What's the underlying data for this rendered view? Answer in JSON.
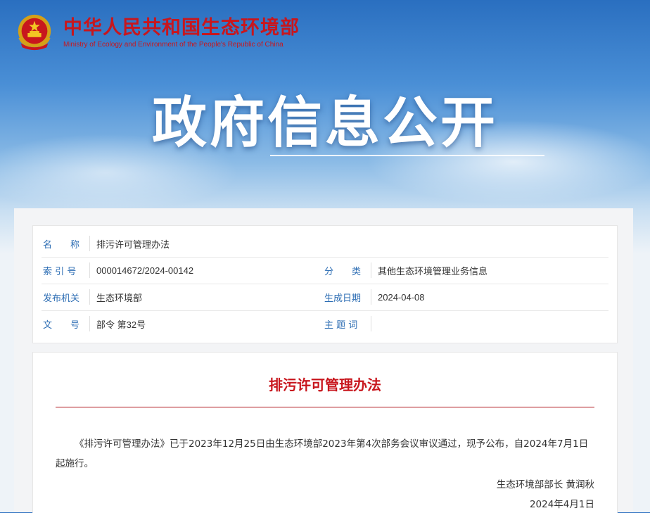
{
  "site": {
    "name_cn": "中华人民共和国生态环境部",
    "name_en": "Ministry of Ecology and Environment of the People's Republic of China",
    "emblem_icon": "national-emblem-icon",
    "brand_color": "#c8161d"
  },
  "banner": {
    "title": "政府信息公开"
  },
  "info": {
    "name_label": "名　　称",
    "name_value": "排污许可管理办法",
    "index_label": "索 引 号",
    "index_value": "000014672/2024-00142",
    "category_label": "分　　类",
    "category_value": "其他生态环境管理业务信息",
    "issuer_label": "发布机关",
    "issuer_value": "生态环境部",
    "date_label": "生成日期",
    "date_value": "2024-04-08",
    "doc_no_label": "文　　号",
    "doc_no_value": "部令 第32号",
    "subject_label": "主 题 词",
    "subject_value": "",
    "label_color": "#2b6cb3"
  },
  "article": {
    "title": "排污许可管理办法",
    "body": "《排污许可管理办法》已于2023年12月25日由生态环境部2023年第4次部务会议审议通过，现予公布，自2024年7月1日起施行。",
    "signer": "生态环境部部长 黄润秋",
    "date": "2024年4月1日"
  }
}
